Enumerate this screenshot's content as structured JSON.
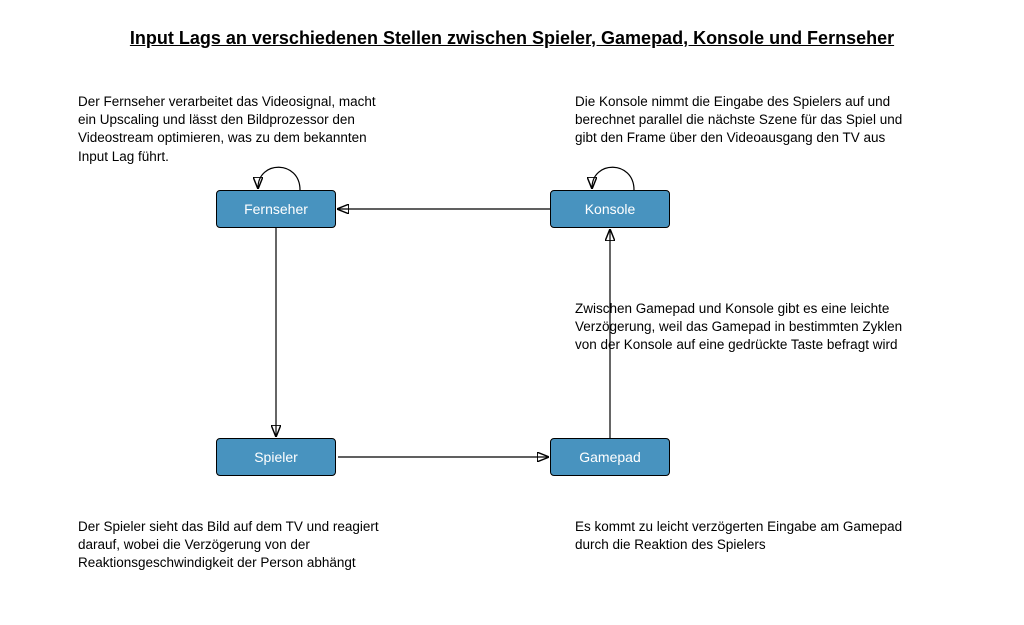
{
  "title": "Input Lags an verschiedenen Stellen zwischen Spieler, Gamepad, Konsole und Fernseher",
  "nodes": {
    "fernseher": "Fernseher",
    "konsole": "Konsole",
    "spieler": "Spieler",
    "gamepad": "Gamepad"
  },
  "captions": {
    "topLeft": "Der Fernseher verarbeitet das Videosignal, macht ein Upscaling und lässt den Bildprozessor den Videostream optimieren, was zu dem bekannten Input Lag führt.",
    "topRight": "Die Konsole nimmt die Eingabe des Spielers auf und berechnet parallel die nächste Szene für das Spiel und gibt den Frame über den Videoausgang den TV aus",
    "midRight": "Zwischen Gamepad und Konsole gibt es  eine leichte Verzögerung, weil das Gamepad in bestimmten Zyklen von der Konsole auf eine gedrückte Taste befragt wird",
    "bottomLeft": "Der Spieler sieht das Bild auf dem TV und reagiert darauf, wobei die Verzögerung von der Reaktionsgeschwindigkeit der Person abhängt",
    "bottomRight": "Es kommt zu leicht verzögerten Eingabe am Gamepad durch die Reaktion des Spielers"
  }
}
